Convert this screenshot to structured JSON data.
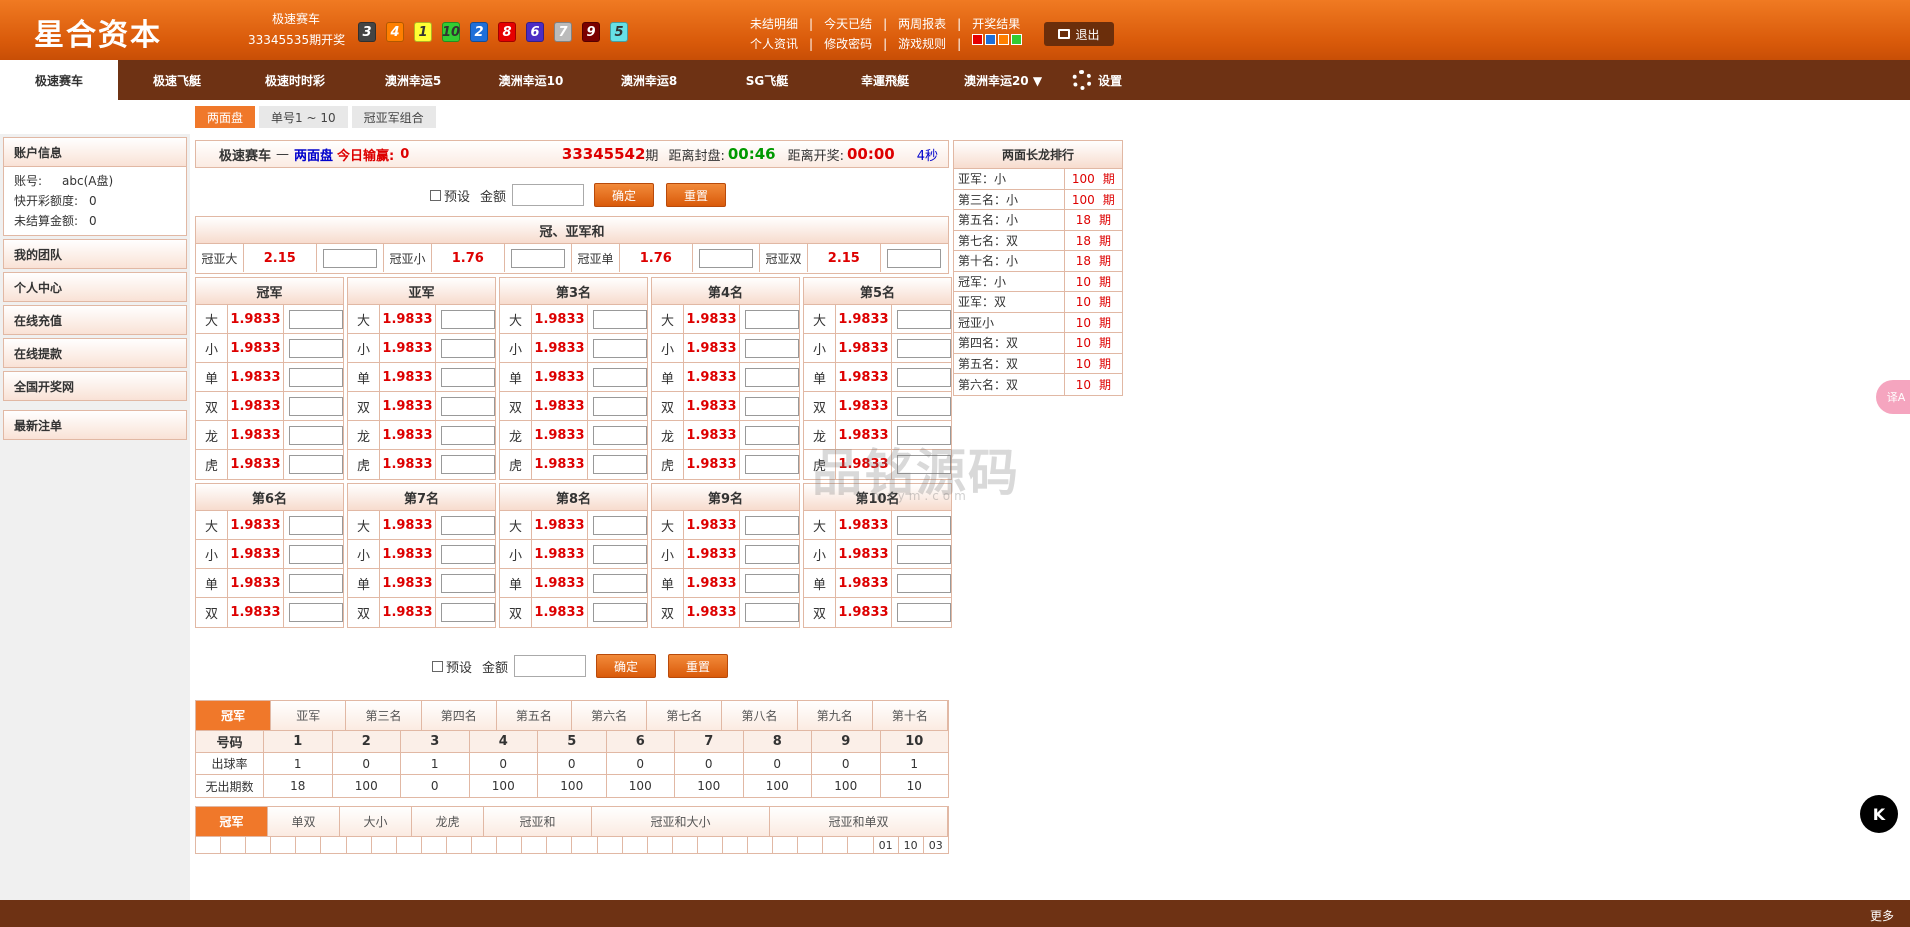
{
  "header": {
    "logo": "星合资本",
    "game_name": "极速赛车",
    "period_text": "33345535期开奖",
    "balls": [
      {
        "n": "3",
        "color": "#444444",
        "text": "#ffffff"
      },
      {
        "n": "4",
        "color": "#ff7f00",
        "text": "#ffffff"
      },
      {
        "n": "1",
        "color": "#ffff33",
        "text": "#333333"
      },
      {
        "n": "10",
        "color": "#33cc33",
        "text": "#333333"
      },
      {
        "n": "2",
        "color": "#1e6fd9",
        "text": "#ffffff"
      },
      {
        "n": "8",
        "color": "#e60000",
        "text": "#ffffff"
      },
      {
        "n": "6",
        "color": "#4b2cc4",
        "text": "#ffffff"
      },
      {
        "n": "7",
        "color": "#bbbbbb",
        "text": "#ffffff"
      },
      {
        "n": "9",
        "color": "#7a0000",
        "text": "#ffffff"
      },
      {
        "n": "5",
        "color": "#66e0e6",
        "text": "#333333"
      }
    ],
    "links_row1": [
      "未结明细",
      "今天已结",
      "两周报表",
      "开奖结果"
    ],
    "links_row2": [
      "个人资讯",
      "修改密码",
      "游戏规则"
    ],
    "sep": "|",
    "color_squares": [
      "#e60000",
      "#1e6fd9",
      "#ff7f00",
      "#33cc33"
    ],
    "logout": "退出"
  },
  "nav": {
    "items": [
      {
        "label": "极速赛车",
        "w": 118
      },
      {
        "label": "极速飞艇",
        "w": 118
      },
      {
        "label": "极速时时彩",
        "w": 118
      },
      {
        "label": "澳洲幸运5",
        "w": 118
      },
      {
        "label": "澳洲幸运10",
        "w": 118
      },
      {
        "label": "澳洲幸运8",
        "w": 118
      },
      {
        "label": "SG飞艇",
        "w": 118
      },
      {
        "label": "幸運飛艇",
        "w": 118
      },
      {
        "label": "澳洲幸运20 ▼",
        "w": 118
      }
    ],
    "settings": "设置"
  },
  "subtabs": [
    "两面盘",
    "单号1 ~ 10",
    "冠亚军组合"
  ],
  "sidebar": {
    "account_title": "账户信息",
    "account_rows": [
      {
        "k": "账号:",
        "v": "abc(A盘)"
      },
      {
        "k": "快开彩额度:",
        "v": "0"
      },
      {
        "k": "未结算金额:",
        "v": "0"
      }
    ],
    "menu": [
      "我的团队",
      "个人中心",
      "在线充值",
      "在线提款",
      "全国开奖网",
      "最新注单"
    ]
  },
  "infobar": {
    "game": "极速赛车",
    "dash": "—",
    "mode": "两面盘",
    "profit_label": "今日输赢:",
    "profit": "0",
    "period": "33345542",
    "period_suffix": "期",
    "close_label": "距离封盘:",
    "close_time": "00:46",
    "open_label": "距离开奖:",
    "open_time": "00:00",
    "refresh": "4秒"
  },
  "form": {
    "preset": "预设",
    "amount": "金额",
    "confirm": "确定",
    "reset": "重置"
  },
  "sum_section": {
    "title": "冠、亚军和",
    "items": [
      {
        "label": "冠亚大",
        "odds": "2.15"
      },
      {
        "label": "冠亚小",
        "odds": "1.76"
      },
      {
        "label": "冠亚单",
        "odds": "1.76"
      },
      {
        "label": "冠亚双",
        "odds": "2.15"
      }
    ]
  },
  "positions_top": [
    "冠军",
    "亚军",
    "第3名",
    "第4名",
    "第5名"
  ],
  "positions_bottom": [
    "第6名",
    "第7名",
    "第8名",
    "第9名",
    "第10名"
  ],
  "bet_top": [
    "大",
    "小",
    "单",
    "双",
    "龙",
    "虎"
  ],
  "bet_bottom": [
    "大",
    "小",
    "单",
    "双"
  ],
  "odds": "1.9833",
  "dragon": {
    "title": "两面长龙排行",
    "unit": "期",
    "rows": [
      {
        "name": "亚军：小",
        "count": "100"
      },
      {
        "name": "第三名：小",
        "count": "100"
      },
      {
        "name": "第五名：小",
        "count": "18"
      },
      {
        "name": "第七名：双",
        "count": "18"
      },
      {
        "name": "第十名：小",
        "count": "18"
      },
      {
        "name": "冠军：小",
        "count": "10"
      },
      {
        "name": "亚军：双",
        "count": "10"
      },
      {
        "name": "冠亚小",
        "count": "10"
      },
      {
        "name": "第四名：双",
        "count": "10"
      },
      {
        "name": "第五名：双",
        "count": "10"
      },
      {
        "name": "第六名：双",
        "count": "10"
      }
    ]
  },
  "stats": {
    "tabs": [
      "冠军",
      "亚军",
      "第三名",
      "第四名",
      "第五名",
      "第六名",
      "第七名",
      "第八名",
      "第九名",
      "第十名"
    ],
    "head_label": "号码",
    "numbers": [
      "1",
      "2",
      "3",
      "4",
      "5",
      "6",
      "7",
      "8",
      "9",
      "10"
    ],
    "rate_label": "出球率",
    "rates": [
      "1",
      "0",
      "1",
      "0",
      "0",
      "0",
      "0",
      "0",
      "0",
      "1"
    ],
    "miss_label": "无出期数",
    "miss": [
      "18",
      "100",
      "0",
      "100",
      "100",
      "100",
      "100",
      "100",
      "100",
      "10"
    ]
  },
  "trend": {
    "tabs": [
      {
        "label": "冠军",
        "w": 72
      },
      {
        "label": "单双",
        "w": 72
      },
      {
        "label": "大小",
        "w": 72
      },
      {
        "label": "龙虎",
        "w": 72
      },
      {
        "label": "冠亚和",
        "w": 108
      },
      {
        "label": "冠亚和大小",
        "w": 178
      },
      {
        "label": "冠亚和单双",
        "w": 178
      }
    ],
    "cells": [
      "",
      "",
      "",
      "",
      "",
      "",
      "",
      "",
      "",
      "",
      "",
      "",
      "",
      "",
      "",
      "",
      "",
      "",
      "",
      "",
      "",
      "",
      "",
      "",
      "",
      "",
      "",
      "01",
      "10",
      "03"
    ]
  },
  "footer": {
    "more": "更多"
  },
  "watermark": {
    "main": "品铭源码",
    "sub": "pmzym.com"
  },
  "floats": {
    "translate": "译A",
    "logo": "K"
  }
}
